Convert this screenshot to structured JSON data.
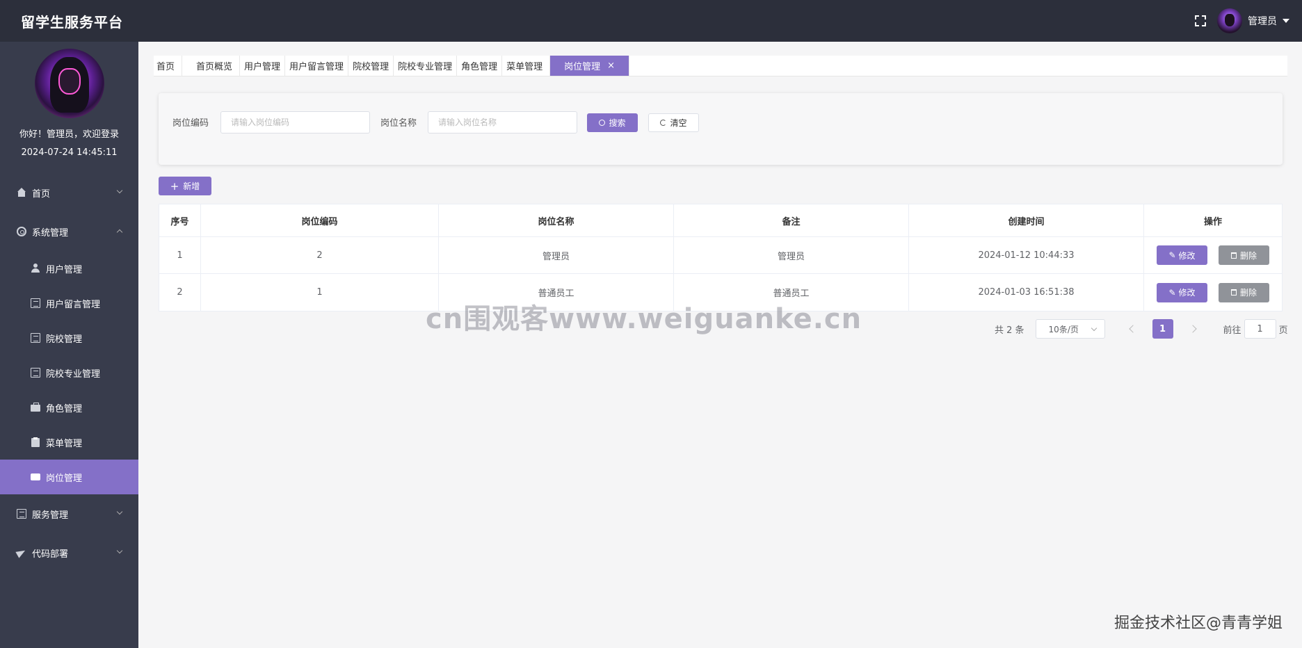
{
  "header": {
    "title": "留学生服务平台",
    "username": "管理员"
  },
  "sidebar": {
    "welcome": "你好！管理员，欢迎登录",
    "datetime": "2024-07-24 14:45:11",
    "menu": [
      {
        "label": "首页",
        "icon": "home-icon"
      },
      {
        "label": "系统管理",
        "icon": "gear-icon"
      },
      {
        "label": "用户管理",
        "icon": "user-icon"
      },
      {
        "label": "用户留言管理",
        "icon": "document-icon"
      },
      {
        "label": "院校管理",
        "icon": "document-icon"
      },
      {
        "label": "院校专业管理",
        "icon": "document-icon"
      },
      {
        "label": "角色管理",
        "icon": "briefcase-icon"
      },
      {
        "label": "菜单管理",
        "icon": "clipboard-icon"
      },
      {
        "label": "岗位管理",
        "icon": "ticket-icon"
      },
      {
        "label": "服务管理",
        "icon": "document-icon"
      },
      {
        "label": "代码部署",
        "icon": "send-icon"
      }
    ]
  },
  "tabs": [
    "首页",
    "首页概览",
    "用户管理",
    "用户留言管理",
    "院校管理",
    "院校专业管理",
    "角色管理",
    "菜单管理",
    "岗位管理"
  ],
  "tab_close": "×",
  "search": {
    "code_label": "岗位编码",
    "code_placeholder": "请输入岗位编码",
    "name_label": "岗位名称",
    "name_placeholder": "请输入岗位名称",
    "search_button": "搜索",
    "clear_button": "清空"
  },
  "add_button": "新增",
  "table": {
    "columns": [
      "序号",
      "岗位编码",
      "岗位名称",
      "备注",
      "创建时间",
      "操作"
    ],
    "rows": [
      [
        "1",
        "2",
        "管理员",
        "管理员",
        "2024-01-12 10:44:33"
      ],
      [
        "2",
        "1",
        "普通员工",
        "普通员工",
        "2024-01-03 16:51:38"
      ]
    ],
    "edit_label": "修改",
    "delete_label": "删除"
  },
  "pagination": {
    "total": "共 2 条",
    "page_size": "10条/页",
    "current_page": "1",
    "goto_label": "前往",
    "goto_value": "1",
    "page_suffix": "页"
  },
  "watermark": "cn围观客www.weiguanke.cn",
  "corner_watermark": "掘金技术社区@青青学姐",
  "colors": {
    "accent": "#8470c8",
    "sidebar_bg": "#383c4c",
    "header_bg": "#2c2f3b",
    "delete_button": "#909399"
  }
}
